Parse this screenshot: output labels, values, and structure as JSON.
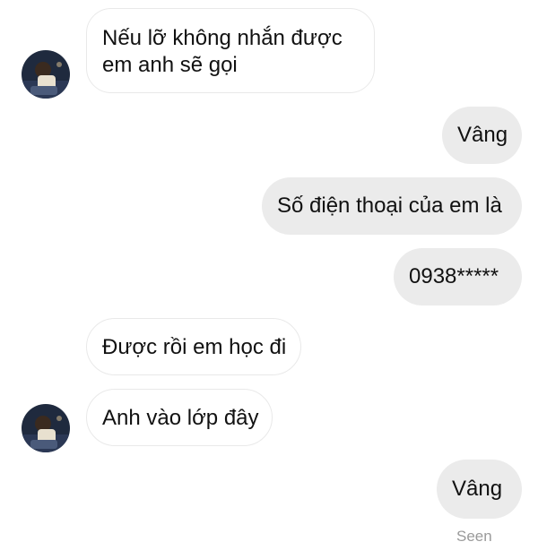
{
  "messages": [
    {
      "direction": "incoming",
      "lines": [
        "Nếu lỡ không nhắn được",
        "em anh sẽ gọi"
      ]
    },
    {
      "direction": "outgoing",
      "text": "Vâng"
    },
    {
      "direction": "outgoing",
      "text": "Số điện thoại của em là"
    },
    {
      "direction": "outgoing",
      "text": "0938*****"
    },
    {
      "direction": "incoming",
      "text": "Được rồi em học đi"
    },
    {
      "direction": "incoming",
      "text": "Anh vào lớp đây"
    },
    {
      "direction": "outgoing",
      "text": "Vâng"
    }
  ],
  "read_receipt": "Seen",
  "colors": {
    "incoming_bubble_bg": "#ffffff",
    "incoming_bubble_border": "#e9e9e9",
    "outgoing_bubble_bg": "#ebebeb",
    "text": "#111111",
    "seen_text": "#9a9a9a"
  },
  "icons": {
    "contact_avatar": "avatar-photo"
  }
}
